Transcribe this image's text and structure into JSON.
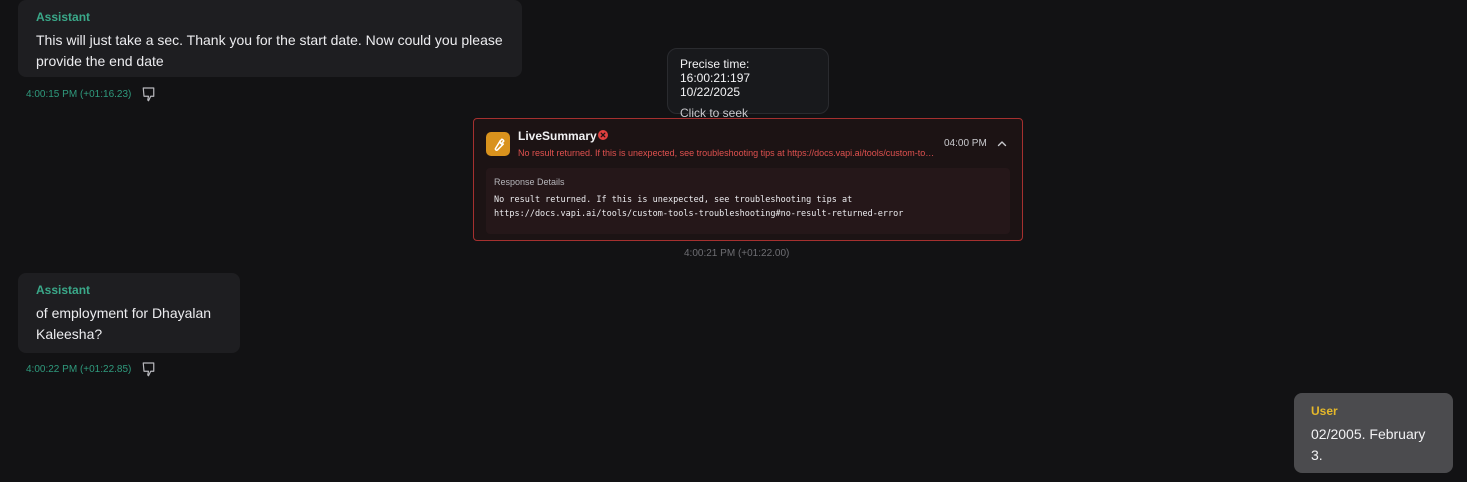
{
  "messages": [
    {
      "speaker": "Assistant",
      "text": "This will just take a sec. Thank you for the start date. Now could you please provide the end date",
      "timestamp": "4:00:15 PM",
      "offset": "(+01:16.23)"
    },
    {
      "speaker": "Assistant",
      "text": "of employment for Dhayalan Kaleesha?",
      "timestamp": "4:00:22 PM",
      "offset": "(+01:22.85)"
    },
    {
      "speaker": "User",
      "text": "02/2005. February 3."
    }
  ],
  "tooltip": {
    "precise_time": "Precise time: 16:00:21:197",
    "date": "10/22/2025",
    "action": "Click to seek"
  },
  "tool_call": {
    "name": "LiveSummary",
    "summary": "No result returned. If this is unexpected, see troubleshooting tips at https://docs.vapi.ai/tools/custom-tools-troubleshooting#no-result-returned-error",
    "time": "04:00 PM",
    "details_label": "Response Details",
    "details_text": "No result returned. If this is unexpected, see troubleshooting tips at\nhttps://docs.vapi.ai/tools/custom-tools-troubleshooting#no-result-returned-error",
    "timestamp": "4:00:21 PM",
    "offset": "(+01:22.00)"
  },
  "icons": {
    "tool": "wrench-icon",
    "error": "error-x-icon",
    "collapse": "chevron-up-icon",
    "feedback": "thumbs-down-icon"
  },
  "colors": {
    "assistant_label": "#3aa889",
    "user_label": "#e5b82a",
    "error_border": "#a5302f",
    "error_text": "#e0514f",
    "tool_icon_bg": "#d9921d"
  }
}
